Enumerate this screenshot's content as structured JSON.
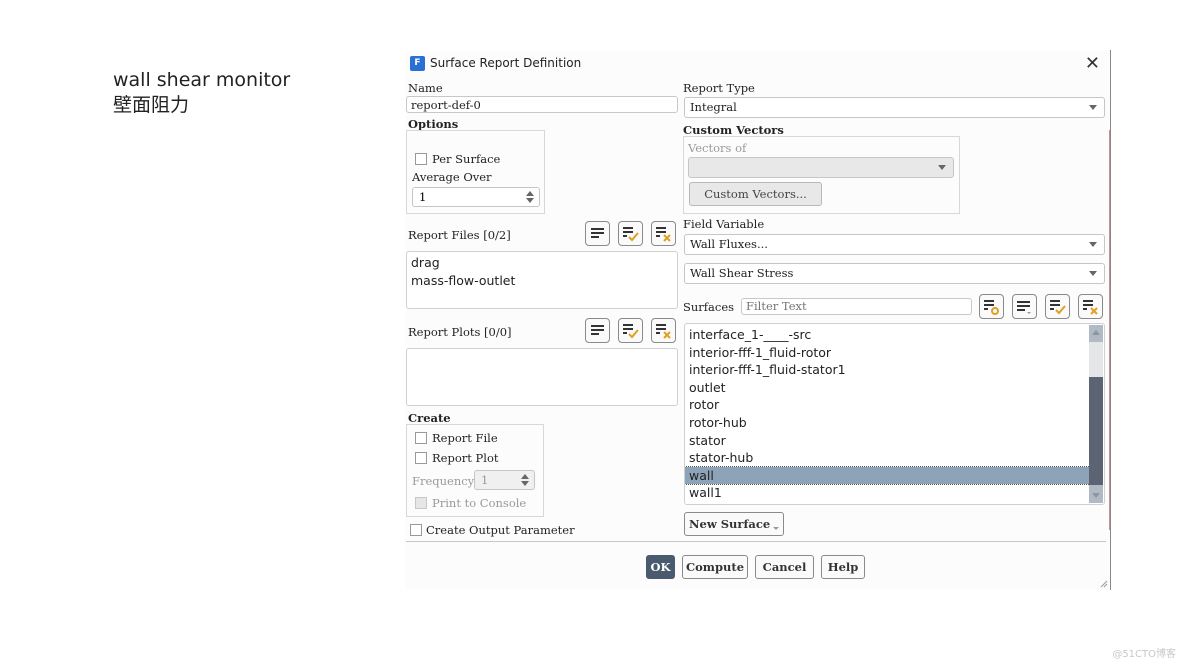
{
  "slide": {
    "title_en": "wall shear monitor",
    "title_cn": "壁面阻力",
    "watermark": "@51CTO博客"
  },
  "dialog": {
    "title": "Surface Report Definition",
    "app_icon_letter": "F",
    "close_glyph": "✕",
    "name": {
      "label": "Name",
      "value": "report-def-0"
    },
    "options": {
      "label": "Options",
      "per_surface_label": "Per Surface",
      "per_surface_checked": false,
      "average_over_label": "Average Over",
      "average_over_value": "1"
    },
    "report_files": {
      "label": "Report Files [0/2]",
      "items": [
        "drag",
        "mass-flow-outlet"
      ]
    },
    "report_plots": {
      "label": "Report Plots [0/0]",
      "items": []
    },
    "create": {
      "label": "Create",
      "report_file_label": "Report File",
      "report_file_checked": false,
      "report_plot_label": "Report Plot",
      "report_plot_checked": false,
      "frequency_label": "Frequency",
      "frequency_value": "1",
      "print_to_console_label": "Print to Console",
      "print_to_console_checked": false
    },
    "create_output_parameter": {
      "label": "Create Output Parameter",
      "checked": false
    },
    "report_type": {
      "label": "Report Type",
      "value": "Integral"
    },
    "custom_vectors": {
      "label": "Custom Vectors",
      "vectors_of_label": "Vectors of",
      "vectors_of_value": "",
      "button_label": "Custom Vectors..."
    },
    "field_variable": {
      "label": "Field Variable",
      "category": "Wall Fluxes...",
      "variable": "Wall Shear Stress"
    },
    "surfaces": {
      "label": "Surfaces",
      "filter_placeholder": "Filter Text",
      "items": [
        {
          "name": "interface_1-____-src",
          "selected": false
        },
        {
          "name": "interior-fff-1_fluid-rotor",
          "selected": false
        },
        {
          "name": "interior-fff-1_fluid-stator1",
          "selected": false
        },
        {
          "name": "outlet",
          "selected": false
        },
        {
          "name": "rotor",
          "selected": false
        },
        {
          "name": "rotor-hub",
          "selected": false
        },
        {
          "name": "stator",
          "selected": false
        },
        {
          "name": "stator-hub",
          "selected": false
        },
        {
          "name": "wall",
          "selected": true
        },
        {
          "name": "wall1",
          "selected": false
        }
      ],
      "new_surface_label": "New Surface"
    },
    "buttons": {
      "ok": "OK",
      "compute": "Compute",
      "cancel": "Cancel",
      "help": "Help"
    },
    "colors": {
      "accent_primary_button": "#4a5b6d",
      "selection": "#8da3b8",
      "check_icon": "#e0a020",
      "scroll_thumb": "#5c6474"
    }
  }
}
